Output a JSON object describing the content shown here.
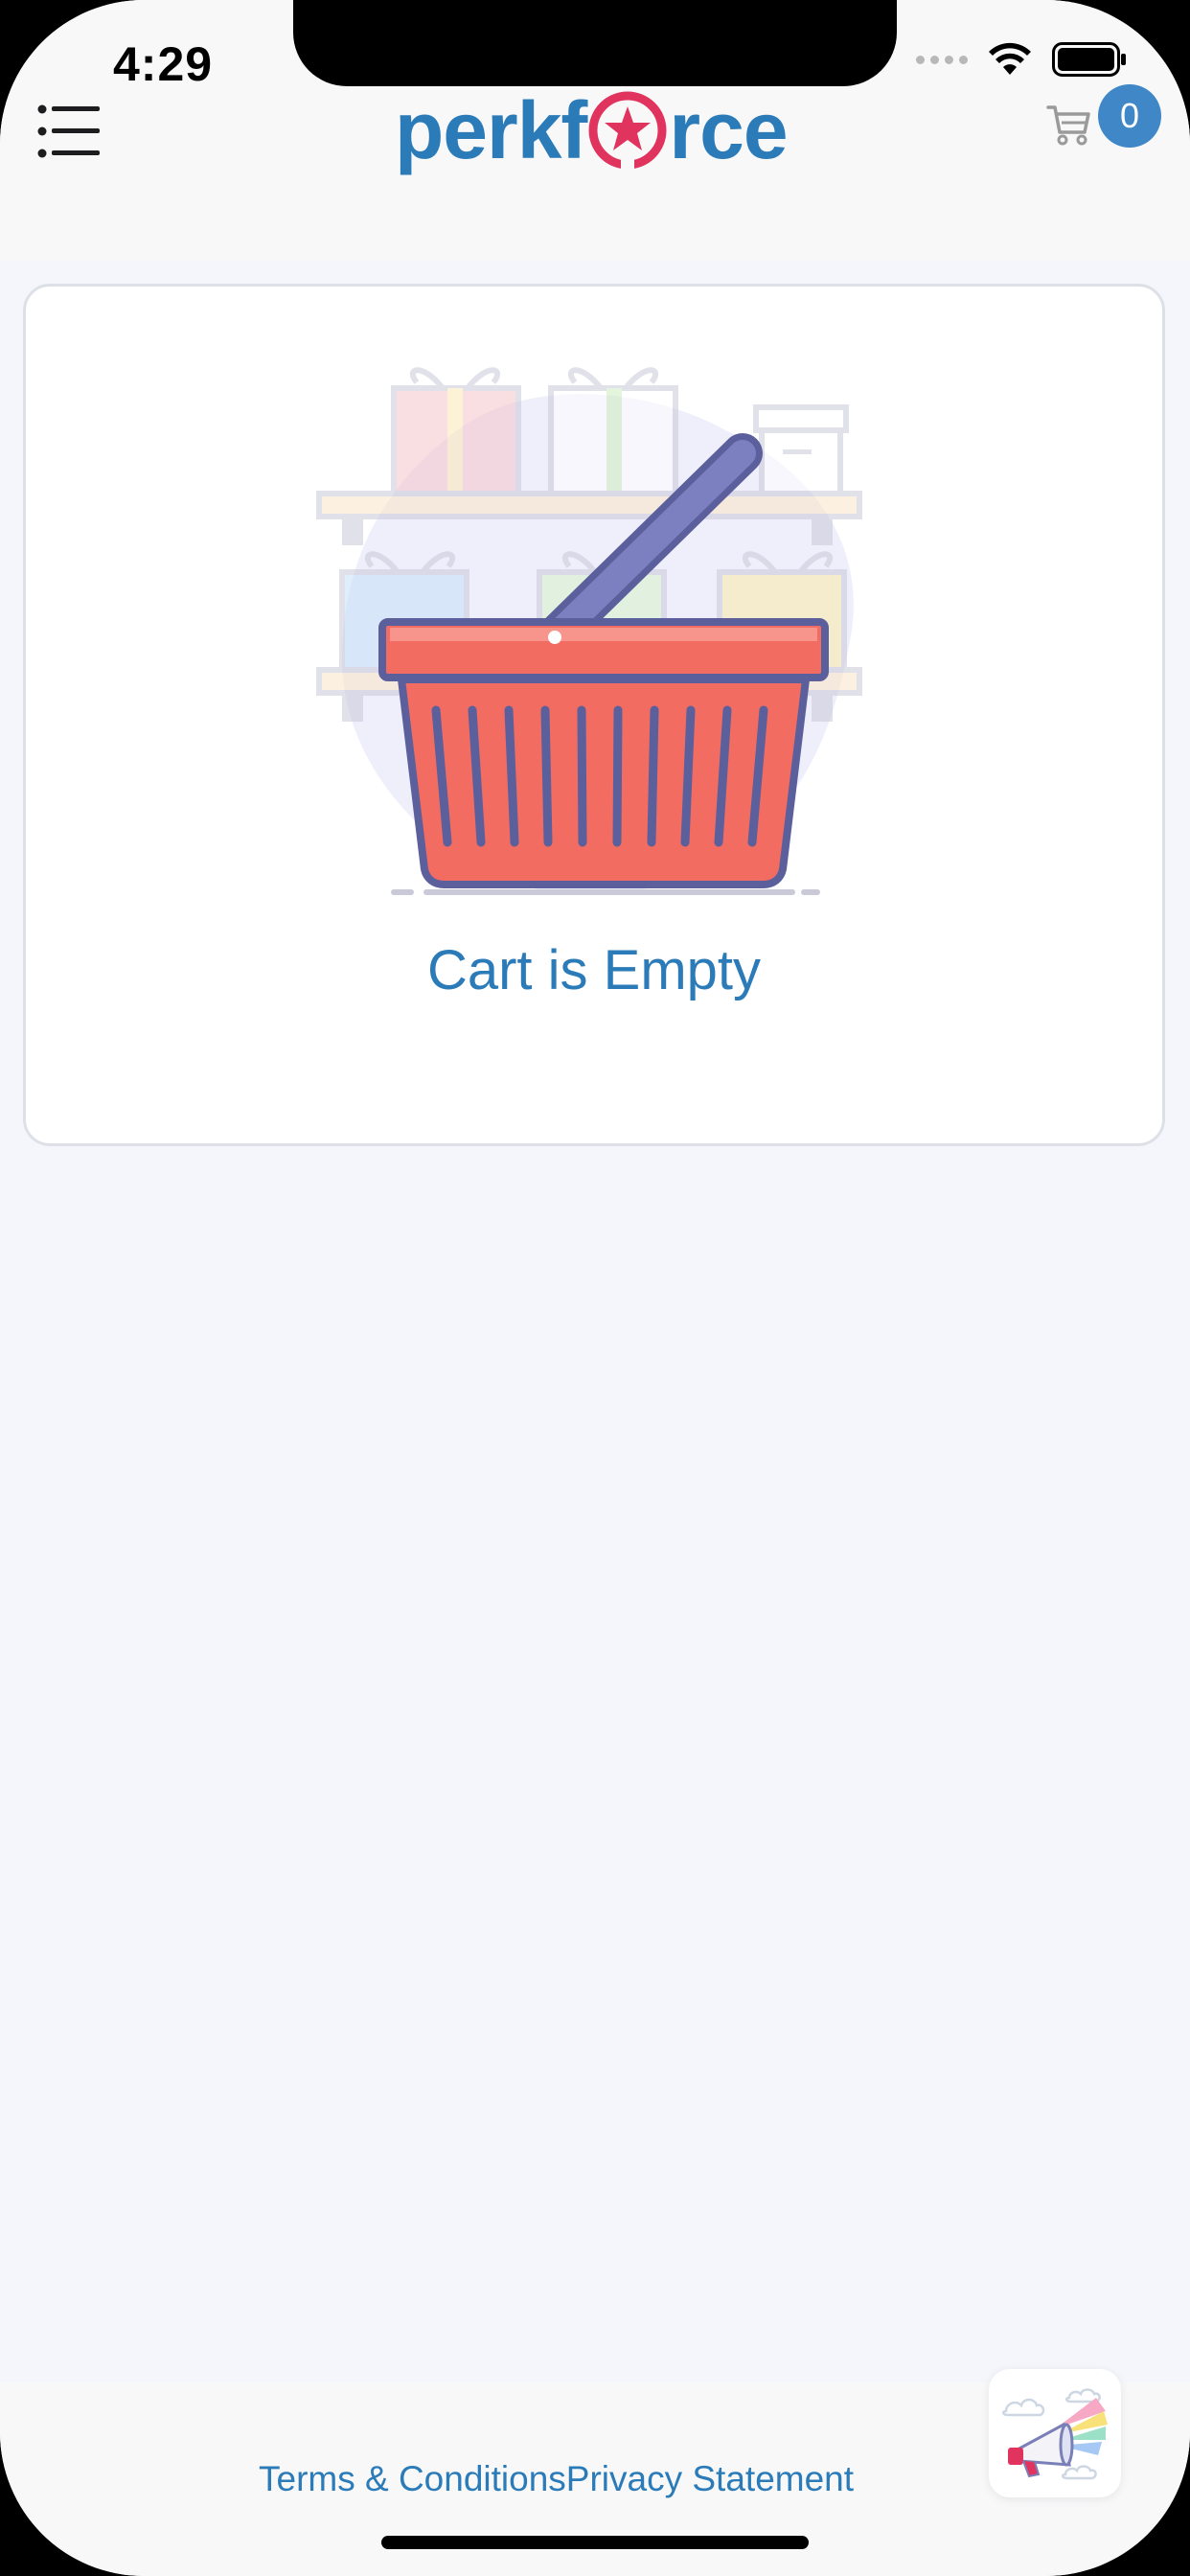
{
  "status_bar": {
    "time": "4:29"
  },
  "header": {
    "logo_prefix": "perkf",
    "logo_suffix": "rce",
    "cart_count": "0",
    "menu_icon": "list-icon",
    "cart_icon": "cart-icon"
  },
  "cart": {
    "empty_message": "Cart is Empty",
    "illustration_icon": "empty-basket-illustration"
  },
  "footer": {
    "terms_label": "Terms & Conditions",
    "privacy_label": "Privacy Statement",
    "announce_icon": "megaphone-icon"
  },
  "colors": {
    "brand_blue": "#2b7bb9",
    "brand_pink": "#e0345f",
    "badge_blue": "#3f87c6",
    "basket_red": "#f26c62",
    "basket_outline": "#5b5f9c",
    "background": "#f4f6fb"
  }
}
